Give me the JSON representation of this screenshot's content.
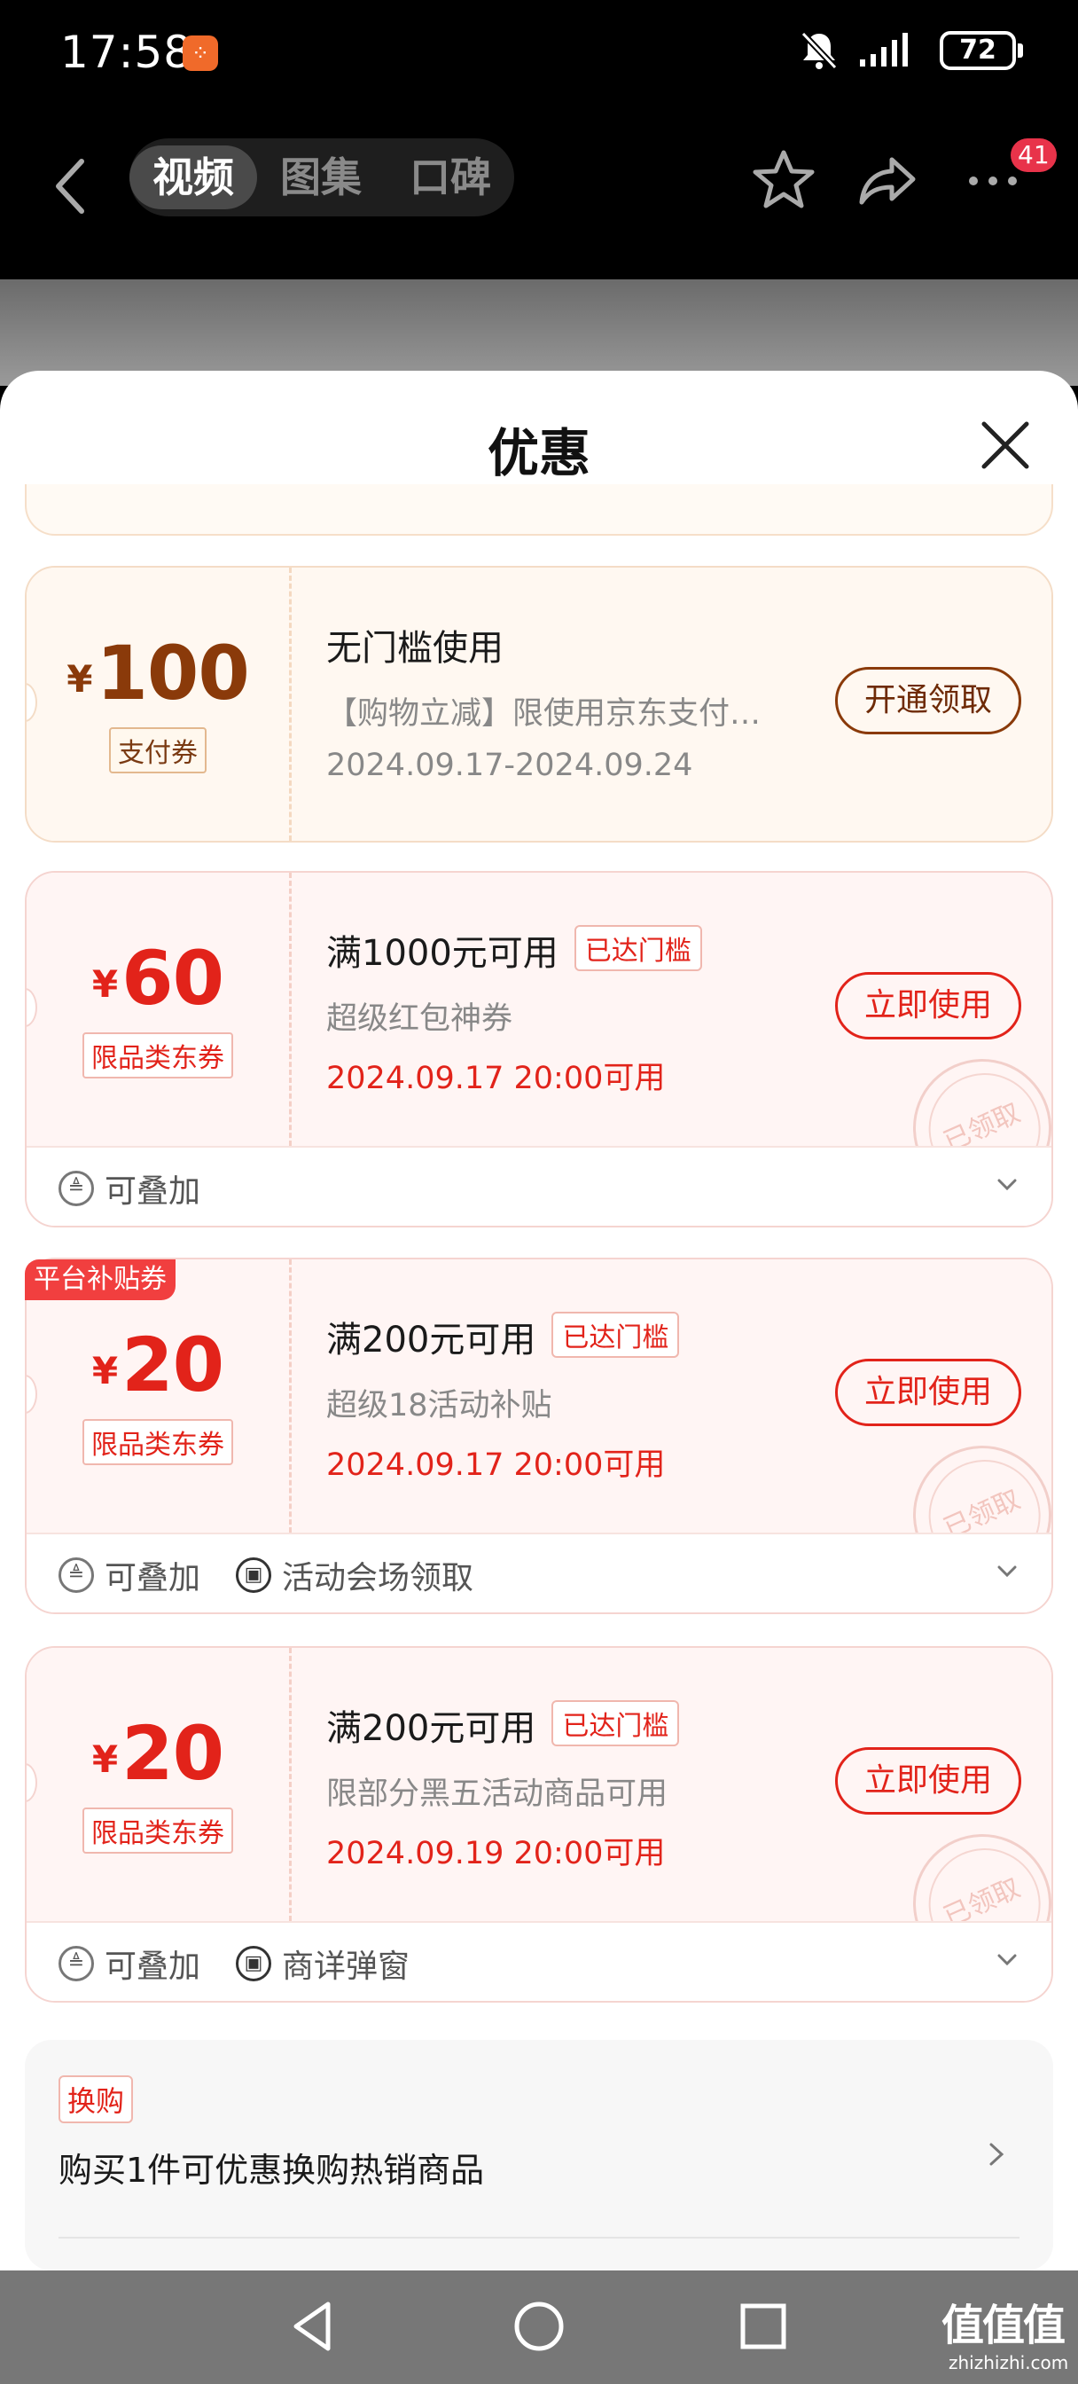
{
  "status_bar": {
    "time": "17:58",
    "battery": "72"
  },
  "nav": {
    "tabs": [
      "视频",
      "图集",
      "口碑"
    ],
    "badge": "41"
  },
  "sheet": {
    "title": "优惠"
  },
  "coupons": [
    {
      "yen": "¥",
      "amount": "100",
      "tag": "支付券",
      "title": "无门槛使用",
      "desc": "【购物立减】限使用京东支付…",
      "date": "2024.09.17-2024.09.24",
      "button": "开通领取"
    },
    {
      "yen": "¥",
      "amount": "60",
      "tag": "限品类东券",
      "title": "满1000元可用",
      "reached": "已达门槛",
      "desc": "超级红包神券",
      "date": "2024.09.17 20:00可用",
      "button": "立即使用",
      "stamp": "已领取",
      "footer": [
        "可叠加"
      ]
    },
    {
      "ribbon": "平台补贴券",
      "yen": "¥",
      "amount": "20",
      "tag": "限品类东券",
      "title": "满200元可用",
      "reached": "已达门槛",
      "desc": "超级18活动补贴",
      "date": "2024.09.17 20:00可用",
      "button": "立即使用",
      "stamp": "已领取",
      "footer": [
        "可叠加",
        "活动会场领取"
      ]
    },
    {
      "yen": "¥",
      "amount": "20",
      "tag": "限品类东券",
      "title": "满200元可用",
      "reached": "已达门槛",
      "desc": "限部分黑五活动商品可用",
      "date": "2024.09.19 20:00可用",
      "button": "立即使用",
      "stamp": "已领取",
      "footer": [
        "可叠加",
        "商详弹窗"
      ]
    }
  ],
  "swap": {
    "label": "换购",
    "text": "购买1件可优惠换购热销商品"
  },
  "watermark": {
    "main": "值值值",
    "sub": "zhizhizhi.com"
  }
}
